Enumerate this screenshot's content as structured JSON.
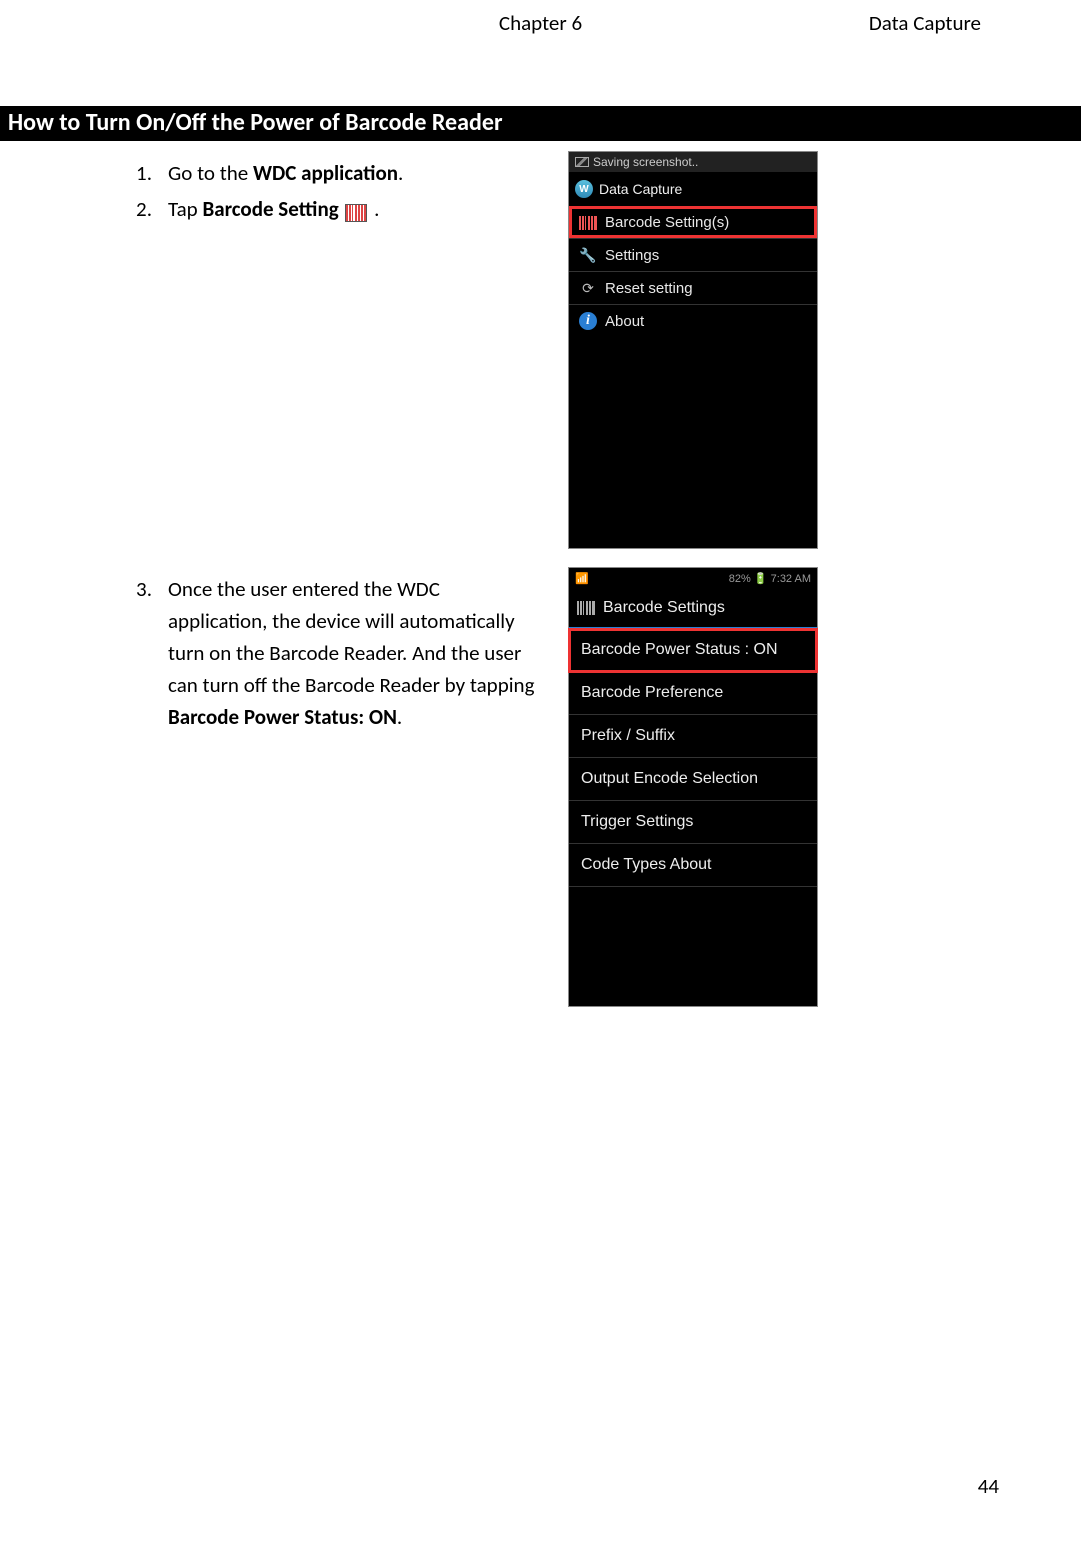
{
  "header": {
    "center": "Chapter 6",
    "right": "Data Capture"
  },
  "section_title": "How to Turn On/Off the Power of Barcode Reader",
  "steps": {
    "s1": {
      "num": "1.",
      "pre": "Go to the ",
      "bold": "WDC application",
      "post": "."
    },
    "s2": {
      "num": "2.",
      "pre": "Tap ",
      "bold": "Barcode Setting",
      "post": " ."
    },
    "s3": {
      "num": "3.",
      "text_a": "Once the user entered the WDC application, the device will automatically turn on the Barcode Reader. And the user can turn off the Barcode Reader by tapping ",
      "bold": "Barcode Power Status: ON",
      "post": "."
    }
  },
  "shot1": {
    "status": "Saving screenshot..",
    "app_title": "Data Capture",
    "items": {
      "barcode": "Barcode Setting(s)",
      "settings": "Settings",
      "reset": "Reset setting",
      "about": "About"
    }
  },
  "shot2": {
    "status_time": "7:32 AM",
    "status_pct": "82%",
    "title": "Barcode Settings",
    "items": {
      "power": "Barcode Power Status : ON",
      "pref": "Barcode Preference",
      "prefix": "Prefix / Suffix",
      "encode": "Output Encode Selection",
      "trigger": "Trigger Settings",
      "codetypes": "Code Types About"
    }
  },
  "page_number": "44"
}
